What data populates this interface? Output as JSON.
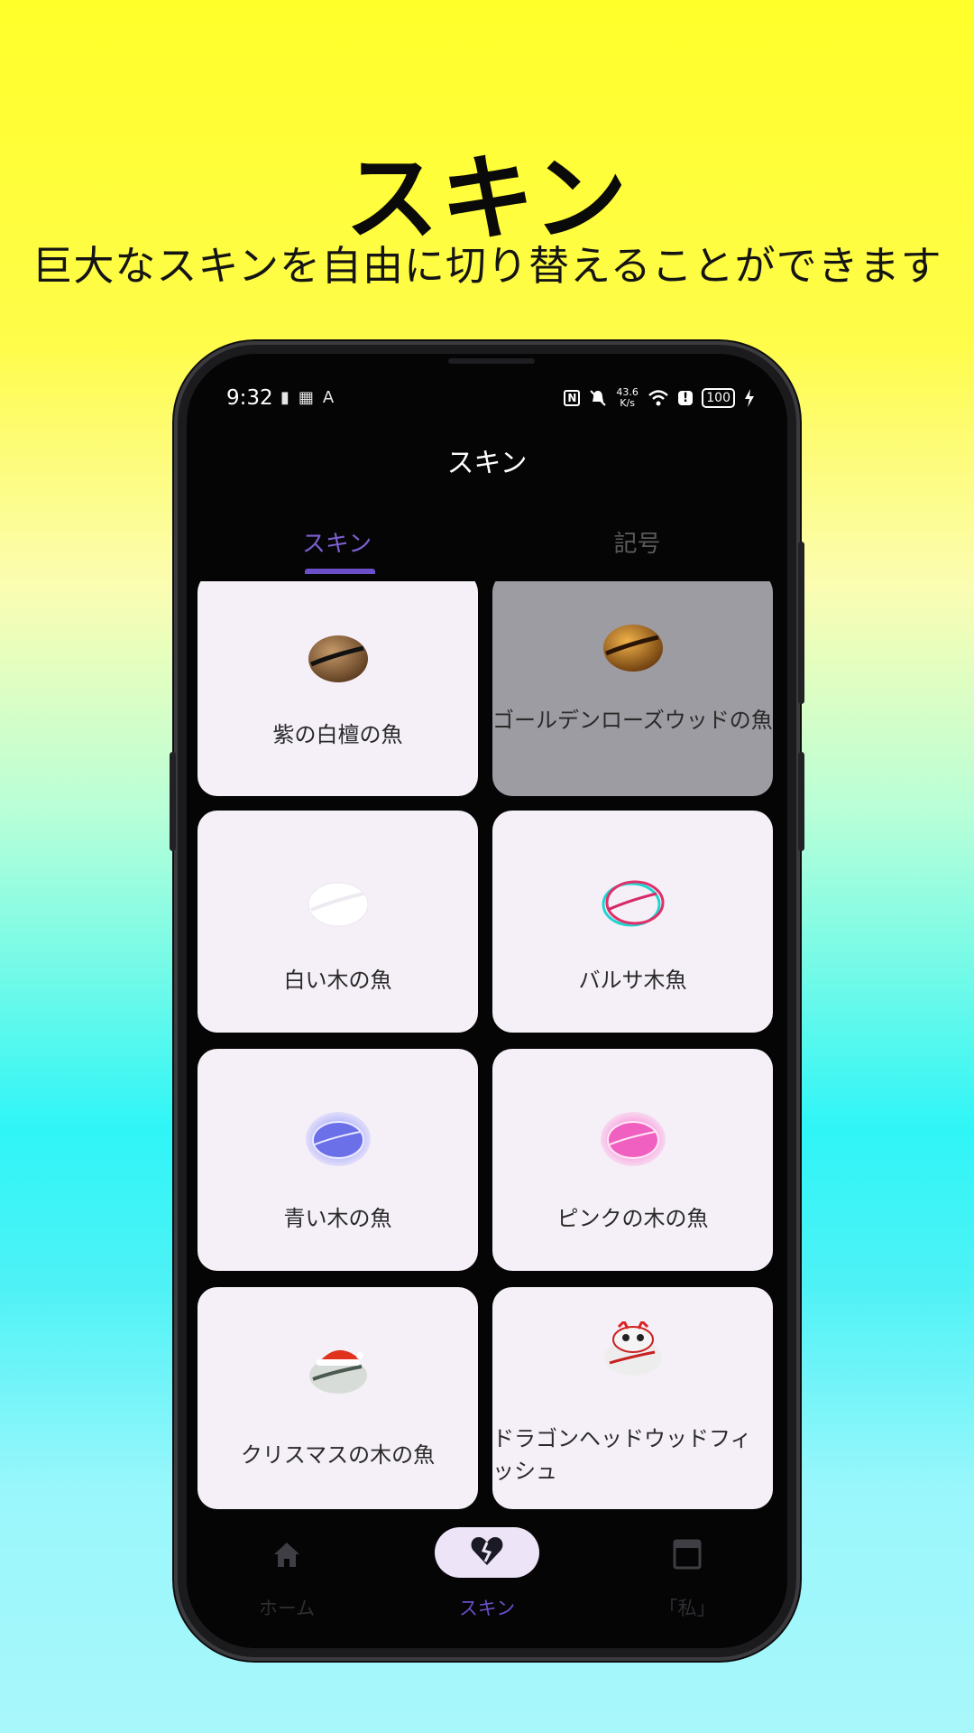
{
  "hero": {
    "title": "スキン",
    "subtitle": "巨大なスキンを自由に切り替えることができます"
  },
  "status_bar": {
    "time": "9:32",
    "left_icons": [
      "battery-saver-icon",
      "app-icon",
      "font-icon"
    ],
    "net_speed_value": "43.6",
    "net_speed_unit": "K/s",
    "battery": "100",
    "right_icons": [
      "nfc-icon",
      "mute-icon",
      "wifi-icon",
      "alert-icon",
      "battery-icon",
      "charging-icon"
    ]
  },
  "app": {
    "title": "スキン",
    "tabs": [
      {
        "label": "スキン",
        "selected": true
      },
      {
        "label": "記号",
        "selected": false
      }
    ]
  },
  "skins": [
    {
      "label": "紫の白檀の魚",
      "selected": false,
      "icon": "wooden-fish-brown-icon"
    },
    {
      "label": "ゴールデンローズウッドの魚",
      "selected": true,
      "icon": "wooden-fish-gold-icon"
    },
    {
      "label": "白い木の魚",
      "selected": false,
      "icon": "wooden-fish-white-icon"
    },
    {
      "label": "バルサ木魚",
      "selected": false,
      "icon": "wooden-fish-glitch-icon"
    },
    {
      "label": "青い木の魚",
      "selected": false,
      "icon": "wooden-fish-blue-neon-icon"
    },
    {
      "label": "ピンクの木の魚",
      "selected": false,
      "icon": "wooden-fish-pink-neon-icon"
    },
    {
      "label": "クリスマスの木の魚",
      "selected": false,
      "icon": "wooden-fish-christmas-icon"
    },
    {
      "label": "ドラゴンヘッドウッドフィッシュ",
      "selected": false,
      "icon": "wooden-fish-dragon-head-icon"
    }
  ],
  "bottom_nav": [
    {
      "label": "ホーム",
      "icon": "home-icon",
      "selected": false
    },
    {
      "label": "スキン",
      "icon": "broken-heart-icon",
      "selected": true
    },
    {
      "label": "「私」",
      "icon": "profile-window-icon",
      "selected": false
    }
  ],
  "colors": {
    "accent": "#6b4fc8",
    "card_bg": "#f5f0f8",
    "card_selected_bg": "#9c9ca2"
  }
}
